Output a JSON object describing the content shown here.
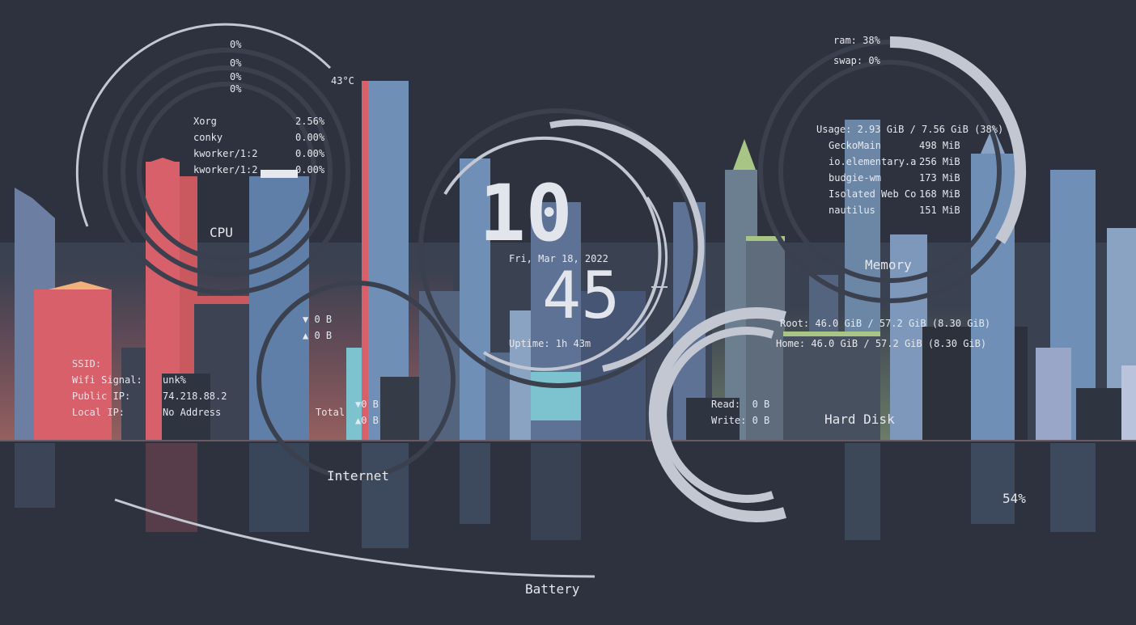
{
  "cpu": {
    "label": "CPU",
    "core_usage": [
      "0%",
      "0%",
      "0%",
      "0%"
    ],
    "temperature": "43°C",
    "processes": [
      {
        "name": "Xorg",
        "usage": "2.56%"
      },
      {
        "name": "conky",
        "usage": "0.00%"
      },
      {
        "name": "kworker/1:2",
        "usage": "0.00%"
      },
      {
        "name": "kworker/1:2",
        "usage": "0.00%"
      }
    ]
  },
  "clock": {
    "hours": "10",
    "minutes": "45",
    "date": "Fri, Mar 18, 2022",
    "uptime": "Uptime: 1h 43m"
  },
  "memory": {
    "label": "Memory",
    "ram": "ram: 38%",
    "swap": "swap: 0%",
    "usage": "Usage: 2.93 GiB / 7.56 GiB (38%)",
    "ram_fraction": 0.38,
    "processes": [
      {
        "name": "GeckoMain",
        "mem": "498 MiB"
      },
      {
        "name": "io.elementary.a",
        "mem": "256 MiB"
      },
      {
        "name": "budgie-wm",
        "mem": "173 MiB"
      },
      {
        "name": "Isolated Web Co",
        "mem": "168 MiB"
      },
      {
        "name": "nautilus",
        "mem": "151 MiB"
      }
    ]
  },
  "network": {
    "label": "Internet",
    "down": "▼ 0 B",
    "up": "▲ 0 B",
    "total_label": "Total",
    "total_down": "▼0 B",
    "total_up": "▲0 B",
    "ssid_label": "SSID:",
    "ssid_value": "",
    "wifi_label": "Wifi Signal:",
    "wifi_value": "unk%",
    "public_ip_label": "Public IP:",
    "public_ip_value": "74.218.88.2",
    "local_ip_label": "Local IP:",
    "local_ip_value": "No Address"
  },
  "disk": {
    "label": "Hard Disk",
    "root": "Root: 46.0 GiB / 57.2 GiB (8.30 GiB)",
    "home": "Home: 46.0 GiB / 57.2 GiB (8.30 GiB)",
    "read": "Read:  0 B",
    "write": "Write: 0 B"
  },
  "battery": {
    "label": "Battery",
    "percent": "54%",
    "fraction": 0.54
  },
  "colors": {
    "background": "#2d323e",
    "ring": "#c3c7d1",
    "ring_faint": "#3a404d",
    "text": "#e6e8ee",
    "city_red": "#d8606a",
    "city_blue": "#6f8fb7",
    "city_cyan": "#7cc3cf",
    "city_green": "#a9c585"
  }
}
